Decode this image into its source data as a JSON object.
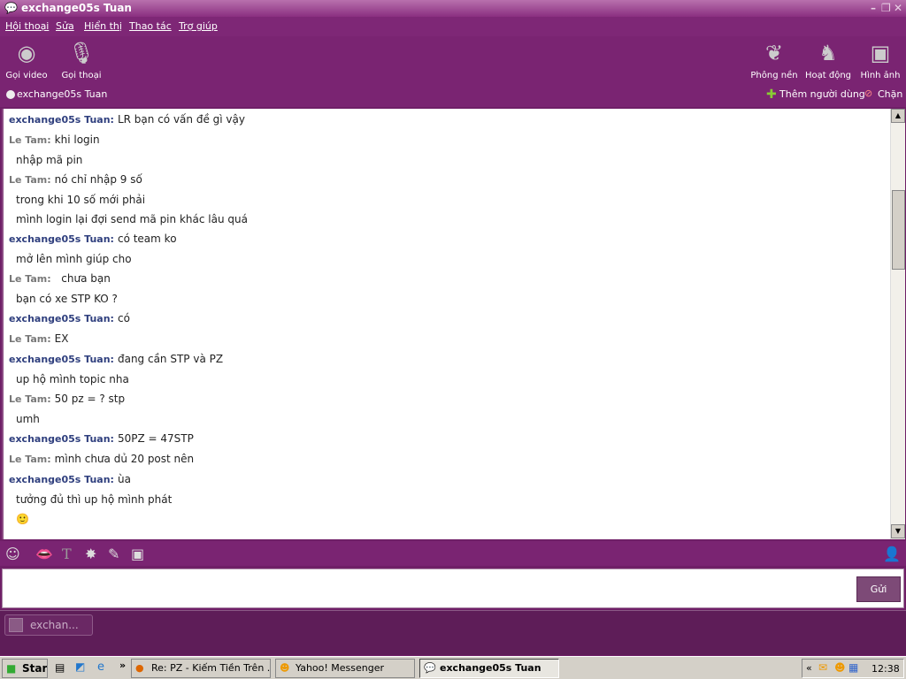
{
  "window": {
    "title": "exchange05s Tuan"
  },
  "menu": [
    "Hội thoại",
    "Sửa",
    "Hiển thị",
    "Thao tác",
    "Trợ giúp"
  ],
  "toolbar": {
    "left": [
      {
        "label": "Gọi video",
        "icon": "webcam-icon"
      },
      {
        "label": "Gọi thoại",
        "icon": "microphone-icon"
      }
    ],
    "right": [
      {
        "label": "Phông nền",
        "icon": "leaf-icon"
      },
      {
        "label": "Hoạt động",
        "icon": "chess-knight-icon"
      },
      {
        "label": "Hình ảnh",
        "icon": "photos-icon"
      }
    ]
  },
  "contact": {
    "name": "exchange05s Tuan",
    "add_label": "Thêm người dùng",
    "block_label": "Chặn"
  },
  "messages": [
    {
      "sender": "exchange05s Tuan:",
      "me": true,
      "text": "LR bạn có vấn đề gì vậy"
    },
    {
      "sender": "Le Tam:",
      "me": false,
      "text": "khi login"
    },
    {
      "text": "nhập mã pin"
    },
    {
      "sender": "Le Tam:",
      "me": false,
      "text": "nó chỉ nhập 9 số"
    },
    {
      "text": "trong khi 10 số mới phải"
    },
    {
      "text": "mình login lại đợi send mã pin khác lâu quá"
    },
    {
      "sender": "exchange05s Tuan:",
      "me": true,
      "text": "có team ko"
    },
    {
      "text": "mở lên mình giúp cho"
    },
    {
      "sender": "Le Tam:",
      "me": false,
      "text": "  chưa bạn"
    },
    {
      "text": "bạn có xe STP KO ?"
    },
    {
      "sender": "exchange05s Tuan:",
      "me": true,
      "text": "có"
    },
    {
      "sender": "Le Tam:",
      "me": false,
      "text": "EX"
    },
    {
      "sender": "exchange05s Tuan:",
      "me": true,
      "text": "đang cần STP và PZ"
    },
    {
      "text": "up hộ mình topic nha"
    },
    {
      "sender": "Le Tam:",
      "me": false,
      "text": "50 pz = ? stp"
    },
    {
      "text": "umh"
    },
    {
      "sender": "exchange05s Tuan:",
      "me": true,
      "text": "50PZ = 47STP"
    },
    {
      "sender": "Le Tam:",
      "me": false,
      "text": "mình chưa dủ 20 post nên"
    },
    {
      "sender": "exchange05s Tuan:",
      "me": true,
      "text": "ùa"
    },
    {
      "text": "tưởng đủ thì up hộ mình phát"
    },
    {
      "text": "🙂"
    }
  ],
  "send_label": "Gửi",
  "conversation_tab": "exchan...",
  "taskbar": {
    "start": "Start",
    "items": [
      "Re: PZ - Kiếm Tiền Trên ...",
      "Yahoo! Messenger",
      "exchange05s Tuan"
    ],
    "clock": "12:38"
  },
  "colors": {
    "purple": "#7a2472",
    "dark_purple": "#5e1d58",
    "me": "#2f3f7e",
    "other": "#777777"
  }
}
